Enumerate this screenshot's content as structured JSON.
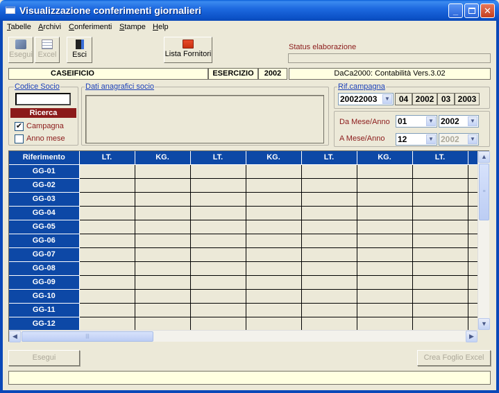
{
  "window": {
    "title": "Visualizzazione conferimenti giornalieri"
  },
  "menu": [
    "Tabelle",
    "Archivi",
    "Conferimenti",
    "Stampe",
    "Help"
  ],
  "toolbar": {
    "esegui": "Esegui",
    "excel": "Excel",
    "esci": "Esci",
    "lista_fornitori": "Lista Fornitori",
    "status_label": "Status elaborazione"
  },
  "infobar": {
    "caseificio": "CASEIFICIO",
    "esercizio_label": "ESERCIZIO",
    "esercizio_value": "2002",
    "version": "DaCa2000: Contabilità Vers.3.02"
  },
  "socio": {
    "codice_label": "Codice Socio",
    "codice_value": "",
    "ricerca_label": "Ricerca",
    "campagna_label": "Campagna",
    "campagna_checked": true,
    "anno_mese_label": "Anno mese",
    "anno_mese_checked": false,
    "dati_label": "Dati anagrafici socio"
  },
  "campagna": {
    "label": "Rif.campagna",
    "selected": "20022003",
    "start_month": "04",
    "start_year": "2002",
    "end_month": "03",
    "end_year": "2003"
  },
  "periodo": {
    "da_label": "Da Mese/Anno",
    "da_mese": "01",
    "da_anno": "2002",
    "a_label": "A Mese/Anno",
    "a_mese": "12",
    "a_anno": "2002"
  },
  "grid": {
    "headers": [
      "Riferimento",
      "LT.",
      "KG.",
      "LT.",
      "KG.",
      "LT.",
      "KG.",
      "LT."
    ],
    "rows": [
      "GG-01",
      "GG-02",
      "GG-03",
      "GG-04",
      "GG-05",
      "GG-06",
      "GG-07",
      "GG-08",
      "GG-09",
      "GG-10",
      "GG-11",
      "GG-12"
    ]
  },
  "buttons": {
    "esegui": "Esegui",
    "crea_excel": "Crea Foglio Excel"
  },
  "colors": {
    "titlebar": "#0c52c8",
    "grid_header": "#0d48a6",
    "label_red": "#8b1a1a",
    "link_blue": "#1a3fb8",
    "info_yellow": "#ffffe1"
  }
}
